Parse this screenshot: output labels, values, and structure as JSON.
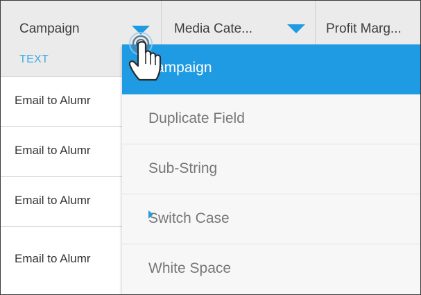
{
  "columns": [
    {
      "title": "Campaign",
      "type": "TEXT"
    },
    {
      "title": "Media Cate..."
    },
    {
      "title": "Profit Marg..."
    }
  ],
  "rows": [
    {
      "value": "Email to Alumr"
    },
    {
      "value": "Email to Alumr"
    },
    {
      "value": "Email to Alumr"
    },
    {
      "value": "Email to Alumr"
    }
  ],
  "menu": {
    "items": [
      {
        "label": "ampaign"
      },
      {
        "label": "Duplicate Field"
      },
      {
        "label": "Sub-String"
      },
      {
        "label": "Switch Case"
      },
      {
        "label": "White Space"
      }
    ]
  },
  "colors": {
    "accent": "#1f9be4",
    "type_label": "#3fa9e3",
    "header_bg": "#ebebeb"
  },
  "icons": {
    "dropdown": "triangle-down-icon",
    "submenu": "chevron-right-icon",
    "cursor": "hand-pointer-icon"
  }
}
